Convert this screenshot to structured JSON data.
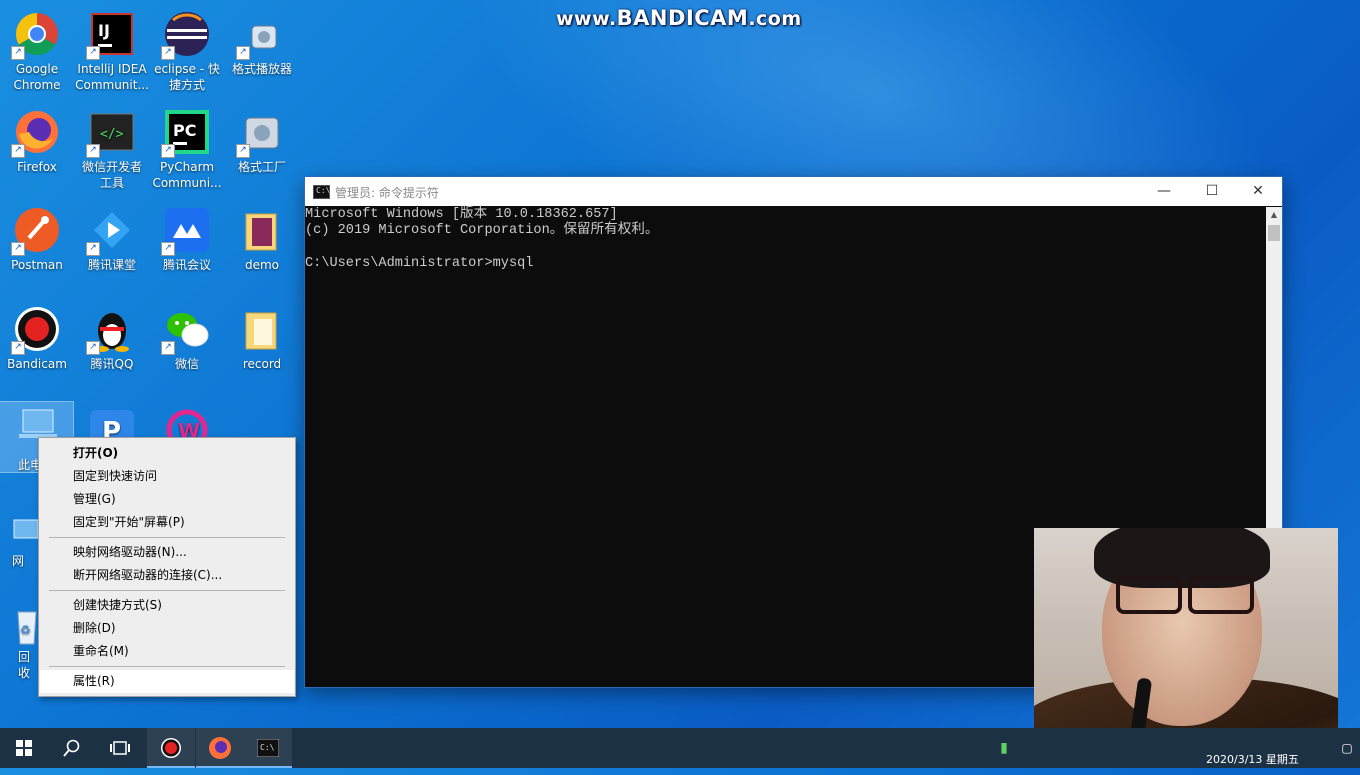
{
  "watermark": {
    "prefix": "www.",
    "brand": "BANDICAM",
    "suffix": ".com"
  },
  "desktop_icons": [
    {
      "label": "Google\nChrome",
      "icon": "chrome-icon"
    },
    {
      "label": "IntelliJ IDEA\nCommunit...",
      "icon": "intellij-icon"
    },
    {
      "label": "eclipse - 快\n捷方式",
      "icon": "eclipse-icon"
    },
    {
      "label": "格式播放器",
      "icon": "media-player-icon"
    },
    {
      "label": "Firefox",
      "icon": "firefox-icon"
    },
    {
      "label": "微信开发者\n工具",
      "icon": "wechat-devtools-icon"
    },
    {
      "label": "PyCharm\nCommuni...",
      "icon": "pycharm-icon"
    },
    {
      "label": "格式工厂",
      "icon": "format-factory-icon"
    },
    {
      "label": "Postman",
      "icon": "postman-icon"
    },
    {
      "label": "腾讯课堂",
      "icon": "tencent-classroom-icon"
    },
    {
      "label": "腾讯会议",
      "icon": "tencent-meeting-icon"
    },
    {
      "label": "demo",
      "icon": "folder-icon"
    },
    {
      "label": "Bandicam",
      "icon": "bandicam-icon"
    },
    {
      "label": "腾讯QQ",
      "icon": "qq-icon"
    },
    {
      "label": "微信",
      "icon": "wechat-icon"
    },
    {
      "label": "record",
      "icon": "folder-icon"
    },
    {
      "label": "此电",
      "icon": "this-pc-icon"
    },
    {
      "label": "网",
      "icon": "network-icon"
    },
    {
      "label": "回收",
      "icon": "recycle-bin-icon"
    }
  ],
  "cmd": {
    "title": "管理员: 命令提示符",
    "lines": [
      "Microsoft Windows [版本 10.0.18362.657]",
      "(c) 2019 Microsoft Corporation。保留所有权利。",
      "",
      "C:\\Users\\Administrator>mysql"
    ],
    "buttons": {
      "minimize": "—",
      "maximize": "☐",
      "close": "✕"
    }
  },
  "context_menu": {
    "items": [
      {
        "label": "打开(O)",
        "bold": true
      },
      {
        "label": "固定到快速访问"
      },
      {
        "label": "管理(G)"
      },
      {
        "label": "固定到\"开始\"屏幕(P)"
      },
      {
        "label": "映射网络驱动器(N)..."
      },
      {
        "label": "断开网络驱动器的连接(C)..."
      },
      {
        "label": "创建快捷方式(S)"
      },
      {
        "label": "删除(D)"
      },
      {
        "label": "重命名(M)"
      },
      {
        "label": "属性(R)",
        "highlighted": true
      }
    ]
  },
  "taskbar": {
    "items": [
      "start-icon",
      "search-icon",
      "task-view-icon",
      "bandicam-icon",
      "firefox-icon",
      "cmd-icon"
    ],
    "clock": "2020/3/13 星期五"
  }
}
